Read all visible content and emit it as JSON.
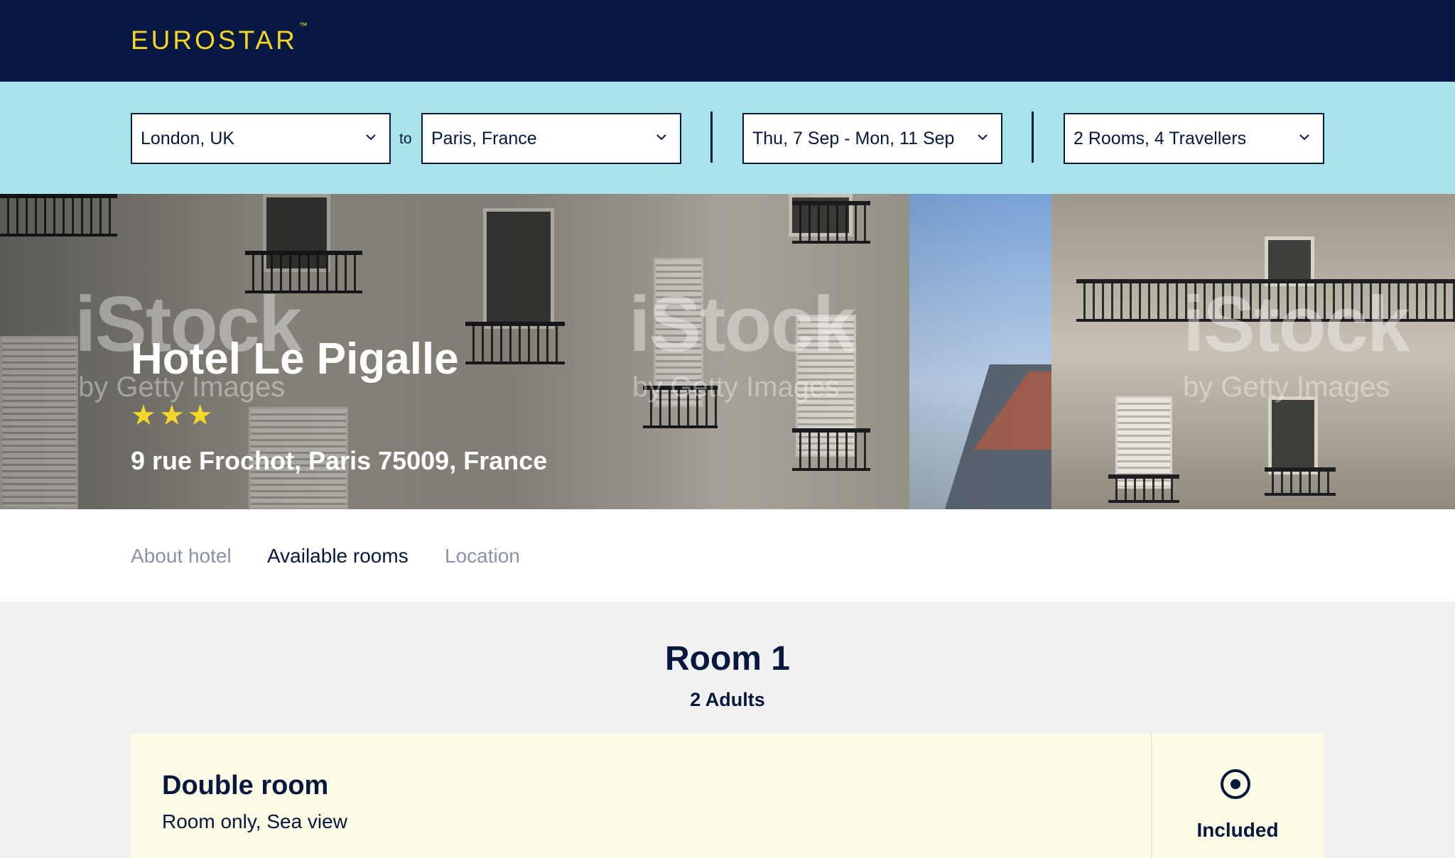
{
  "brand": {
    "logo_text": "EUROSTAR",
    "logo_mark": "™"
  },
  "search": {
    "origin": "London, UK",
    "to_label": "to",
    "destination": "Paris, France",
    "dates": "Thu, 7 Sep - Mon, 11 Sep",
    "guests": "2 Rooms, 4 Travellers"
  },
  "hero": {
    "hotel_name": "Hotel Le Pigalle",
    "stars": "★★★",
    "star_rating": 3,
    "address": "9 rue Frochot, Paris 75009, France",
    "watermark": "iStock",
    "watermark_sub": "by Getty Images"
  },
  "tabs": [
    {
      "label": "About hotel"
    },
    {
      "label": "Available rooms"
    },
    {
      "label": "Location"
    }
  ],
  "room_section": {
    "title": "Room 1",
    "subtitle": "2 Adults",
    "card": {
      "name": "Double room",
      "description": "Room only, Sea view",
      "status": "Included"
    }
  },
  "colors": {
    "navy": "#071842",
    "accent_yellow": "#f4d726",
    "search_bg": "#a8e3ea",
    "card_bg": "#fdfae5"
  }
}
